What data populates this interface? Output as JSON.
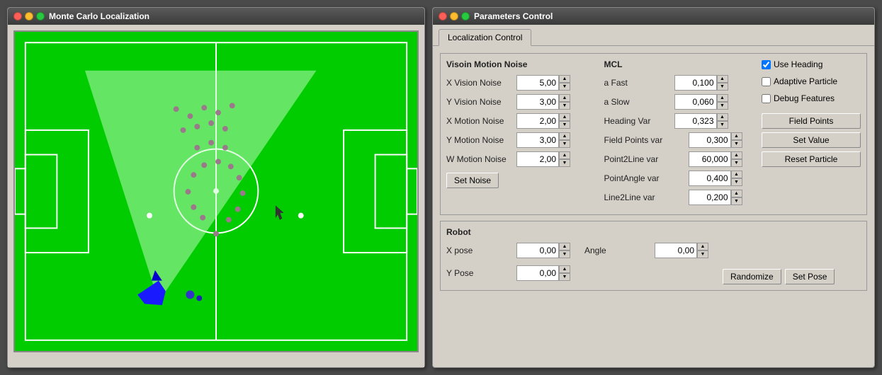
{
  "mcl_window": {
    "title": "Monte Carlo Localization",
    "traffic_lights": [
      "red",
      "yellow",
      "green"
    ]
  },
  "params_window": {
    "title": "Parameters Control",
    "traffic_lights": [
      "red",
      "yellow",
      "green"
    ]
  },
  "tab": {
    "label": "Localization Control"
  },
  "vision_motion_noise": {
    "section_title": "Visoin Motion Noise",
    "fields": [
      {
        "label": "X Vision Noise",
        "value": "5,00"
      },
      {
        "label": "Y Vision Noise",
        "value": "3,00"
      },
      {
        "label": "X Motion Noise",
        "value": "2,00"
      },
      {
        "label": "Y Motion Noise",
        "value": "3,00"
      },
      {
        "label": "W Motion Noise",
        "value": "2,00"
      }
    ],
    "set_noise_btn": "Set Noise"
  },
  "mcl": {
    "section_title": "MCL",
    "fields": [
      {
        "label": "a Fast",
        "value": "0,100"
      },
      {
        "label": "a Slow",
        "value": "0,060"
      },
      {
        "label": "Heading Var",
        "value": "0,323"
      },
      {
        "label": "Field Points var",
        "value": "0,300"
      },
      {
        "label": "Point2Line var",
        "value": "60,000"
      },
      {
        "label": "PointAngle var",
        "value": "0,400"
      },
      {
        "label": "Line2Line var",
        "value": "0,200"
      }
    ],
    "checkboxes": [
      {
        "label": "Use Heading",
        "checked": true
      },
      {
        "label": "Adaptive Particle",
        "checked": false
      },
      {
        "label": "Debug Features",
        "checked": false
      }
    ],
    "buttons": [
      "Field Points",
      "Set Value",
      "Reset Particle"
    ]
  },
  "robot": {
    "section_title": "Robot",
    "x_pose_label": "X pose",
    "x_pose_value": "0,00",
    "y_pose_label": "Y Pose",
    "y_pose_value": "0,00",
    "angle_label": "Angle",
    "angle_value": "0,00",
    "randomize_btn": "Randomize",
    "set_pose_btn": "Set Pose"
  }
}
